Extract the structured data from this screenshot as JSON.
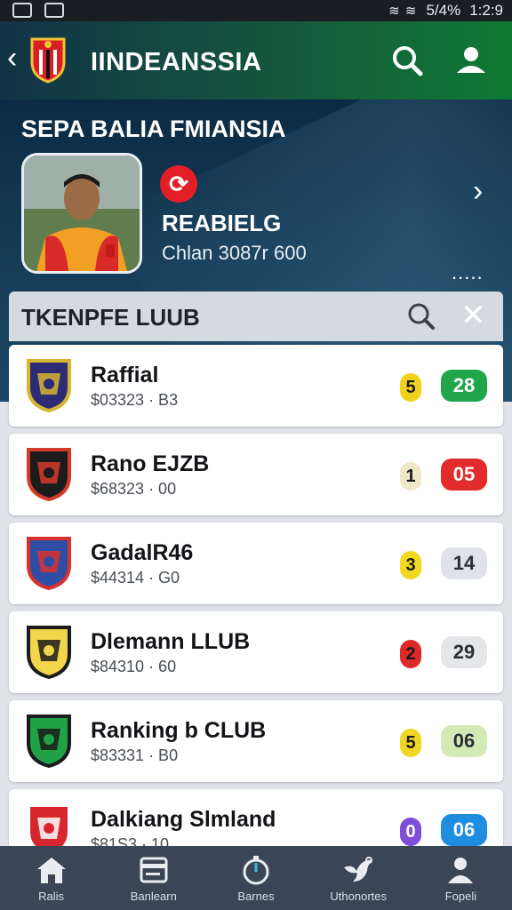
{
  "status_bar": {
    "signal": "5/4%",
    "time": "1:2:9"
  },
  "header": {
    "title": "IINDEANSSIA"
  },
  "hero": {
    "title": "SEPA BALIA FMIANSIA",
    "player_name": "REABIELG",
    "player_meta": "Chlan 3087r 600",
    "more": "....."
  },
  "section": {
    "title": "TKENPFE LUUB",
    "close": "✕"
  },
  "clubs": [
    {
      "name": "Raffial",
      "sub": "$03323 · B3",
      "rank": "5",
      "score": "28",
      "rank_color": "#f2d11c",
      "score_bg": "#1fa64a",
      "score_fg": "#ffffff",
      "crest_primary": "#2d2b75",
      "crest_secondary": "#d6b630"
    },
    {
      "name": "Rano EJZB",
      "sub": "$68323 · 00",
      "rank": "1",
      "score": "05",
      "rank_color": "#efe7c8",
      "score_bg": "#e32b2b",
      "score_fg": "#ffffff",
      "crest_primary": "#1c1c1c",
      "crest_secondary": "#d33a2a"
    },
    {
      "name": "GadalR46",
      "sub": "$44314 · G0",
      "rank": "3",
      "score": "14",
      "rank_color": "#f0d91e",
      "score_bg": "#dfe3e8",
      "score_fg": "#2b2f33",
      "crest_primary": "#2f4ea3",
      "crest_secondary": "#d6322f"
    },
    {
      "name": "Dlemann LLUB",
      "sub": "$84310 · 60",
      "rank": "2",
      "score": "29",
      "rank_color": "#df2828",
      "score_bg": "#e4e6e9",
      "score_fg": "#2b2f33",
      "crest_primary": "#f1d64b",
      "crest_secondary": "#1b1b1b"
    },
    {
      "name": "Ranking b CLUB",
      "sub": "$83331 · B0",
      "rank": "5",
      "score": "06",
      "rank_color": "#f0d624",
      "score_bg": "#d4eab6",
      "score_fg": "#2b2f33",
      "crest_primary": "#20a146",
      "crest_secondary": "#1b1b1b"
    },
    {
      "name": "Dalkiang Slmland",
      "sub": "$81S3 · 10",
      "rank": "0",
      "score": "06",
      "rank_color": "#7e4fd6",
      "score_bg": "#1f8de0",
      "score_fg": "#ffffff",
      "crest_primary": "#d8262e",
      "crest_secondary": "#ffffff"
    }
  ],
  "nav": [
    {
      "label": "Ralis",
      "icon": "home-icon"
    },
    {
      "label": "Banlearn",
      "icon": "card-icon"
    },
    {
      "label": "Barnes",
      "icon": "stopwatch-icon"
    },
    {
      "label": "Uthonortes",
      "icon": "bird-icon"
    },
    {
      "label": "Fopeli",
      "icon": "person-icon"
    }
  ],
  "colors": {
    "header_start": "#123347",
    "header_end": "#0f7a33",
    "nav_bg": "#3a4656"
  }
}
